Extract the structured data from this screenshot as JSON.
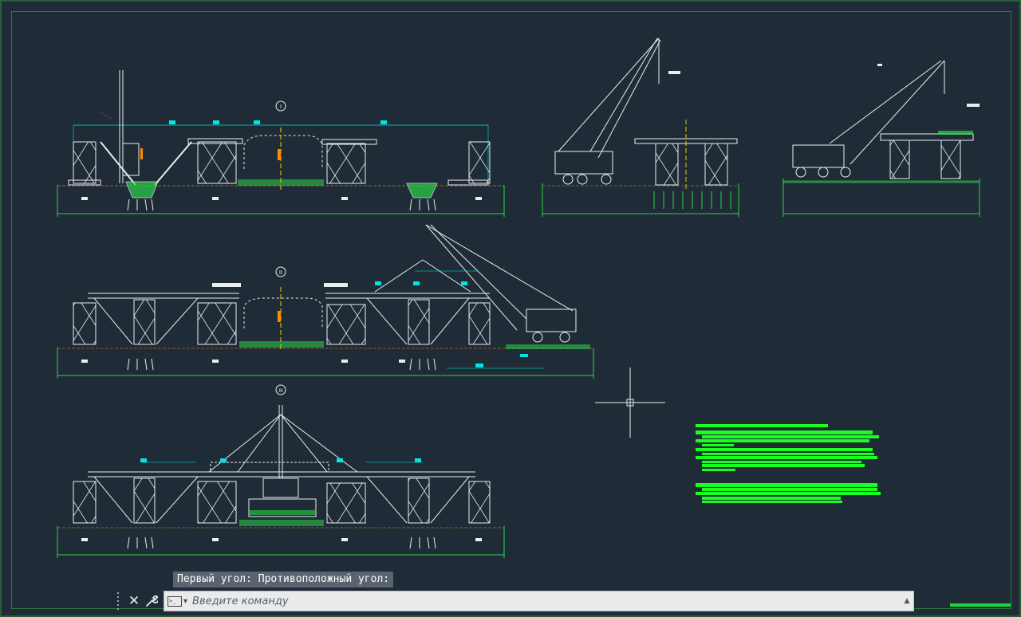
{
  "colors": {
    "background": "#1f2b36",
    "white_lines": "#e8eef2",
    "cyan": "#00e5e5",
    "green": "#2bd44a",
    "bright_green": "#19ff1f",
    "orange": "#ff8c00",
    "yellow": "#e8d000",
    "brown": "#8b5a2b",
    "magenta": "#b030c0"
  },
  "sections": [
    {
      "label": "I",
      "name": "stage-1"
    },
    {
      "label": "II",
      "name": "stage-2"
    },
    {
      "label": "III",
      "name": "stage-3"
    }
  ],
  "command_line": {
    "prompt_history": "Первый угол: Противоположный угол:",
    "placeholder": "Введите команду",
    "close_icon": "close-icon",
    "customize_icon": "wrench-icon",
    "prompt_icon": "terminal-icon"
  }
}
